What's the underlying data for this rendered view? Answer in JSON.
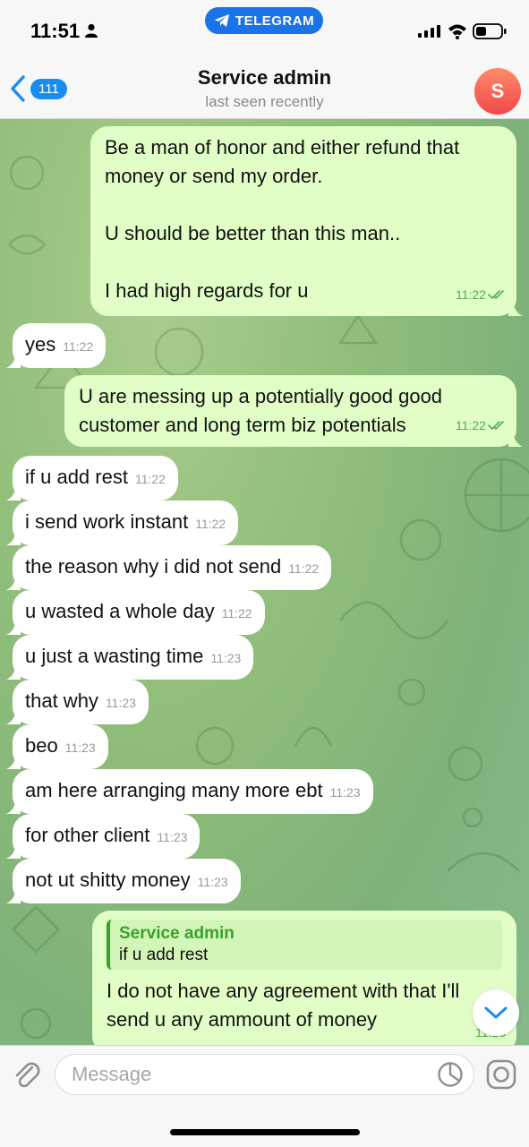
{
  "status_bar": {
    "time": "11:51",
    "app_pill": "TELEGRAM"
  },
  "header": {
    "back_count": "111",
    "title": "Service admin",
    "subtitle": "last seen recently",
    "avatar_letter": "S"
  },
  "messages": [
    {
      "dir": "out",
      "lines": [
        "Be a man of honor and either refund that",
        "money or send my order.",
        "",
        "U should be better than this man..",
        "",
        "I had high regards for u"
      ],
      "time": "11:22",
      "read": true
    },
    {
      "dir": "in",
      "text": "yes",
      "time": "11:22"
    },
    {
      "dir": "out",
      "lines": [
        "U are messing up a potentially good good",
        "customer and long term biz potentials"
      ],
      "time": "11:22",
      "read": true
    },
    {
      "dir": "in",
      "text": "if u add rest",
      "time": "11:22"
    },
    {
      "dir": "in",
      "text": "i send work instant",
      "time": "11:22"
    },
    {
      "dir": "in",
      "text": "the reason why i did not send",
      "time": "11:22"
    },
    {
      "dir": "in",
      "text": "u wasted a whole day",
      "time": "11:22"
    },
    {
      "dir": "in",
      "text": "u just a wasting time",
      "time": "11:23"
    },
    {
      "dir": "in",
      "text": "that why",
      "time": "11:23"
    },
    {
      "dir": "in",
      "text": "beo",
      "time": "11:23"
    },
    {
      "dir": "in",
      "text": "am here arranging many more ebt",
      "time": "11:23"
    },
    {
      "dir": "in",
      "text": "for other client",
      "time": "11:23"
    },
    {
      "dir": "in",
      "text": "not ut shitty money",
      "time": "11:23"
    },
    {
      "dir": "out",
      "reply_to_name": "Service admin",
      "reply_to_text": "if u add rest",
      "lines": [
        "I do not have any agreement with that I'll",
        "send u any ammount of money"
      ],
      "time": "11:23"
    }
  ],
  "input": {
    "placeholder": "Message"
  },
  "icons": [
    "person-icon",
    "telegram-icon",
    "signal-icon",
    "wifi-icon",
    "battery-icon",
    "back-chevron-icon",
    "attach-icon",
    "sticker-icon",
    "camera-icon",
    "chevron-down-icon",
    "double-check-icon"
  ],
  "colors": {
    "outgoing_bubble": "#e1fec6",
    "incoming_bubble": "#ffffff",
    "accent": "#1a8cf0",
    "read_tick": "#4fae4e"
  }
}
